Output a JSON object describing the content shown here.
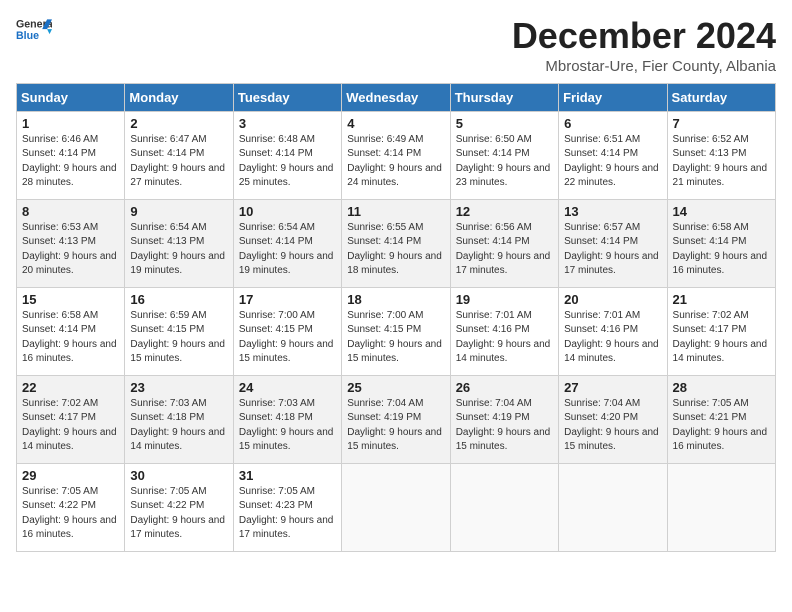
{
  "header": {
    "logo_general": "General",
    "logo_blue": "Blue",
    "month_title": "December 2024",
    "subtitle": "Mbrostar-Ure, Fier County, Albania"
  },
  "days_of_week": [
    "Sunday",
    "Monday",
    "Tuesday",
    "Wednesday",
    "Thursday",
    "Friday",
    "Saturday"
  ],
  "weeks": [
    [
      {
        "day": 1,
        "sunrise": "Sunrise: 6:46 AM",
        "sunset": "Sunset: 4:14 PM",
        "daylight": "Daylight: 9 hours and 28 minutes."
      },
      {
        "day": 2,
        "sunrise": "Sunrise: 6:47 AM",
        "sunset": "Sunset: 4:14 PM",
        "daylight": "Daylight: 9 hours and 27 minutes."
      },
      {
        "day": 3,
        "sunrise": "Sunrise: 6:48 AM",
        "sunset": "Sunset: 4:14 PM",
        "daylight": "Daylight: 9 hours and 25 minutes."
      },
      {
        "day": 4,
        "sunrise": "Sunrise: 6:49 AM",
        "sunset": "Sunset: 4:14 PM",
        "daylight": "Daylight: 9 hours and 24 minutes."
      },
      {
        "day": 5,
        "sunrise": "Sunrise: 6:50 AM",
        "sunset": "Sunset: 4:14 PM",
        "daylight": "Daylight: 9 hours and 23 minutes."
      },
      {
        "day": 6,
        "sunrise": "Sunrise: 6:51 AM",
        "sunset": "Sunset: 4:14 PM",
        "daylight": "Daylight: 9 hours and 22 minutes."
      },
      {
        "day": 7,
        "sunrise": "Sunrise: 6:52 AM",
        "sunset": "Sunset: 4:13 PM",
        "daylight": "Daylight: 9 hours and 21 minutes."
      }
    ],
    [
      {
        "day": 8,
        "sunrise": "Sunrise: 6:53 AM",
        "sunset": "Sunset: 4:13 PM",
        "daylight": "Daylight: 9 hours and 20 minutes."
      },
      {
        "day": 9,
        "sunrise": "Sunrise: 6:54 AM",
        "sunset": "Sunset: 4:13 PM",
        "daylight": "Daylight: 9 hours and 19 minutes."
      },
      {
        "day": 10,
        "sunrise": "Sunrise: 6:54 AM",
        "sunset": "Sunset: 4:14 PM",
        "daylight": "Daylight: 9 hours and 19 minutes."
      },
      {
        "day": 11,
        "sunrise": "Sunrise: 6:55 AM",
        "sunset": "Sunset: 4:14 PM",
        "daylight": "Daylight: 9 hours and 18 minutes."
      },
      {
        "day": 12,
        "sunrise": "Sunrise: 6:56 AM",
        "sunset": "Sunset: 4:14 PM",
        "daylight": "Daylight: 9 hours and 17 minutes."
      },
      {
        "day": 13,
        "sunrise": "Sunrise: 6:57 AM",
        "sunset": "Sunset: 4:14 PM",
        "daylight": "Daylight: 9 hours and 17 minutes."
      },
      {
        "day": 14,
        "sunrise": "Sunrise: 6:58 AM",
        "sunset": "Sunset: 4:14 PM",
        "daylight": "Daylight: 9 hours and 16 minutes."
      }
    ],
    [
      {
        "day": 15,
        "sunrise": "Sunrise: 6:58 AM",
        "sunset": "Sunset: 4:14 PM",
        "daylight": "Daylight: 9 hours and 16 minutes."
      },
      {
        "day": 16,
        "sunrise": "Sunrise: 6:59 AM",
        "sunset": "Sunset: 4:15 PM",
        "daylight": "Daylight: 9 hours and 15 minutes."
      },
      {
        "day": 17,
        "sunrise": "Sunrise: 7:00 AM",
        "sunset": "Sunset: 4:15 PM",
        "daylight": "Daylight: 9 hours and 15 minutes."
      },
      {
        "day": 18,
        "sunrise": "Sunrise: 7:00 AM",
        "sunset": "Sunset: 4:15 PM",
        "daylight": "Daylight: 9 hours and 15 minutes."
      },
      {
        "day": 19,
        "sunrise": "Sunrise: 7:01 AM",
        "sunset": "Sunset: 4:16 PM",
        "daylight": "Daylight: 9 hours and 14 minutes."
      },
      {
        "day": 20,
        "sunrise": "Sunrise: 7:01 AM",
        "sunset": "Sunset: 4:16 PM",
        "daylight": "Daylight: 9 hours and 14 minutes."
      },
      {
        "day": 21,
        "sunrise": "Sunrise: 7:02 AM",
        "sunset": "Sunset: 4:17 PM",
        "daylight": "Daylight: 9 hours and 14 minutes."
      }
    ],
    [
      {
        "day": 22,
        "sunrise": "Sunrise: 7:02 AM",
        "sunset": "Sunset: 4:17 PM",
        "daylight": "Daylight: 9 hours and 14 minutes."
      },
      {
        "day": 23,
        "sunrise": "Sunrise: 7:03 AM",
        "sunset": "Sunset: 4:18 PM",
        "daylight": "Daylight: 9 hours and 14 minutes."
      },
      {
        "day": 24,
        "sunrise": "Sunrise: 7:03 AM",
        "sunset": "Sunset: 4:18 PM",
        "daylight": "Daylight: 9 hours and 15 minutes."
      },
      {
        "day": 25,
        "sunrise": "Sunrise: 7:04 AM",
        "sunset": "Sunset: 4:19 PM",
        "daylight": "Daylight: 9 hours and 15 minutes."
      },
      {
        "day": 26,
        "sunrise": "Sunrise: 7:04 AM",
        "sunset": "Sunset: 4:19 PM",
        "daylight": "Daylight: 9 hours and 15 minutes."
      },
      {
        "day": 27,
        "sunrise": "Sunrise: 7:04 AM",
        "sunset": "Sunset: 4:20 PM",
        "daylight": "Daylight: 9 hours and 15 minutes."
      },
      {
        "day": 28,
        "sunrise": "Sunrise: 7:05 AM",
        "sunset": "Sunset: 4:21 PM",
        "daylight": "Daylight: 9 hours and 16 minutes."
      }
    ],
    [
      {
        "day": 29,
        "sunrise": "Sunrise: 7:05 AM",
        "sunset": "Sunset: 4:22 PM",
        "daylight": "Daylight: 9 hours and 16 minutes."
      },
      {
        "day": 30,
        "sunrise": "Sunrise: 7:05 AM",
        "sunset": "Sunset: 4:22 PM",
        "daylight": "Daylight: 9 hours and 17 minutes."
      },
      {
        "day": 31,
        "sunrise": "Sunrise: 7:05 AM",
        "sunset": "Sunset: 4:23 PM",
        "daylight": "Daylight: 9 hours and 17 minutes."
      },
      null,
      null,
      null,
      null
    ]
  ]
}
